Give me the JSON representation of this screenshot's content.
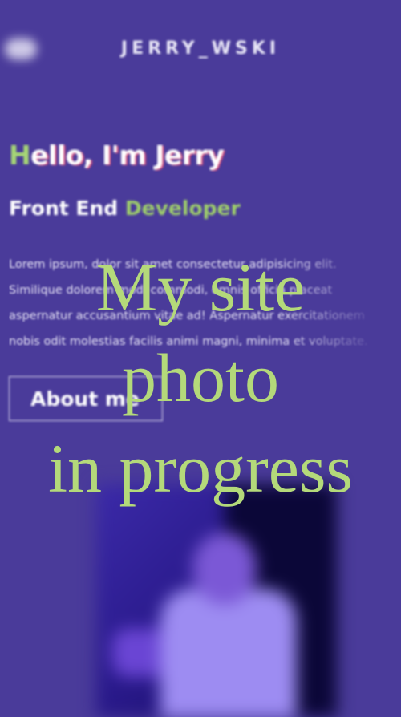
{
  "header": {
    "logo": "JERRY_WSKI",
    "menu_icon": "hamburger-icon"
  },
  "hero": {
    "greeting_first_letter": "H",
    "greeting_rest": "ello, I'm Jerry",
    "role_prefix": "Front End ",
    "role_accent": "Developer",
    "intro": "Lorem ipsum, dolor sit amet consectetur adipisicing elit. Similique dolorem modi commodi, omnis officia placeat aspernatur accusantium vitae ad! Aspernatur exercitationem nobis odit molestias facilis animi magni, minima et voluptate.",
    "about_button": "About me"
  },
  "photo": {
    "overlay_line1": "My site",
    "overlay_line2": "photo",
    "overlay_line3": "in progress"
  },
  "colors": {
    "background": "#4a3b9a",
    "accent_green": "#9dcc6b",
    "overlay_green": "#b4d97a",
    "text_white": "#ffffff"
  }
}
